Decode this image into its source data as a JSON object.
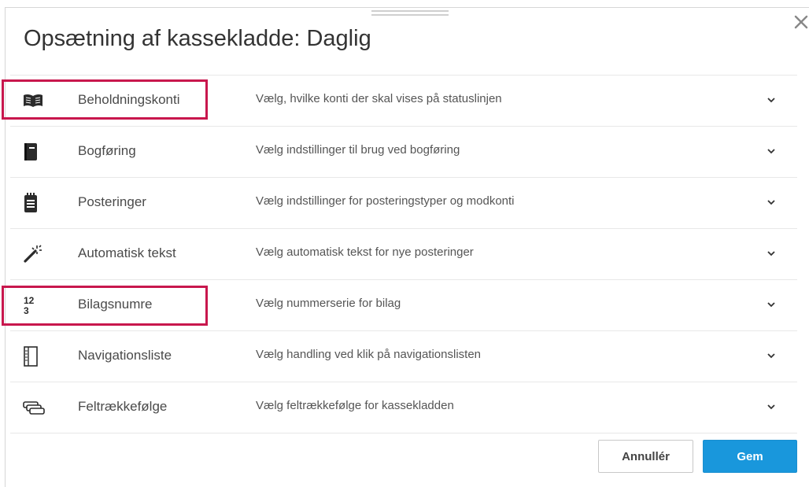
{
  "dialog": {
    "title": "Opsætning af kassekladde: Daglig",
    "close_icon": "close-icon"
  },
  "sections": [
    {
      "icon": "open-book-icon",
      "label": "Beholdningskonti",
      "description": "Vælg, hvilke konti der skal vises på statuslinjen",
      "highlighted": true
    },
    {
      "icon": "notebook-icon",
      "label": "Bogføring",
      "description": "Vælg indstillinger til brug ved bogføring",
      "highlighted": false
    },
    {
      "icon": "notepad-icon",
      "label": "Posteringer",
      "description": "Vælg indstillinger for posteringstyper og modkonti",
      "highlighted": false
    },
    {
      "icon": "magic-wand-icon",
      "label": "Automatisk tekst",
      "description": "Vælg automatisk tekst for nye posteringer",
      "highlighted": false
    },
    {
      "icon": "numbers-icon",
      "label": "Bilagsnumre",
      "description": "Vælg nummerserie for bilag",
      "highlighted": true
    },
    {
      "icon": "sidebar-list-icon",
      "label": "Navigationsliste",
      "description": "Vælg handling ved klik på navigationslisten",
      "highlighted": false
    },
    {
      "icon": "field-order-icon",
      "label": "Feltrækkefølge",
      "description": "Vælg feltrækkefølge for kassekladden",
      "highlighted": false
    }
  ],
  "icon_glyphs": {
    "numbers_top": "12",
    "numbers_bottom": "3"
  },
  "buttons": {
    "cancel_label": "Annullér",
    "save_label": "Gem"
  },
  "colors": {
    "accent": "#1997dc",
    "highlight": "#c8174d",
    "title": "#333333"
  }
}
